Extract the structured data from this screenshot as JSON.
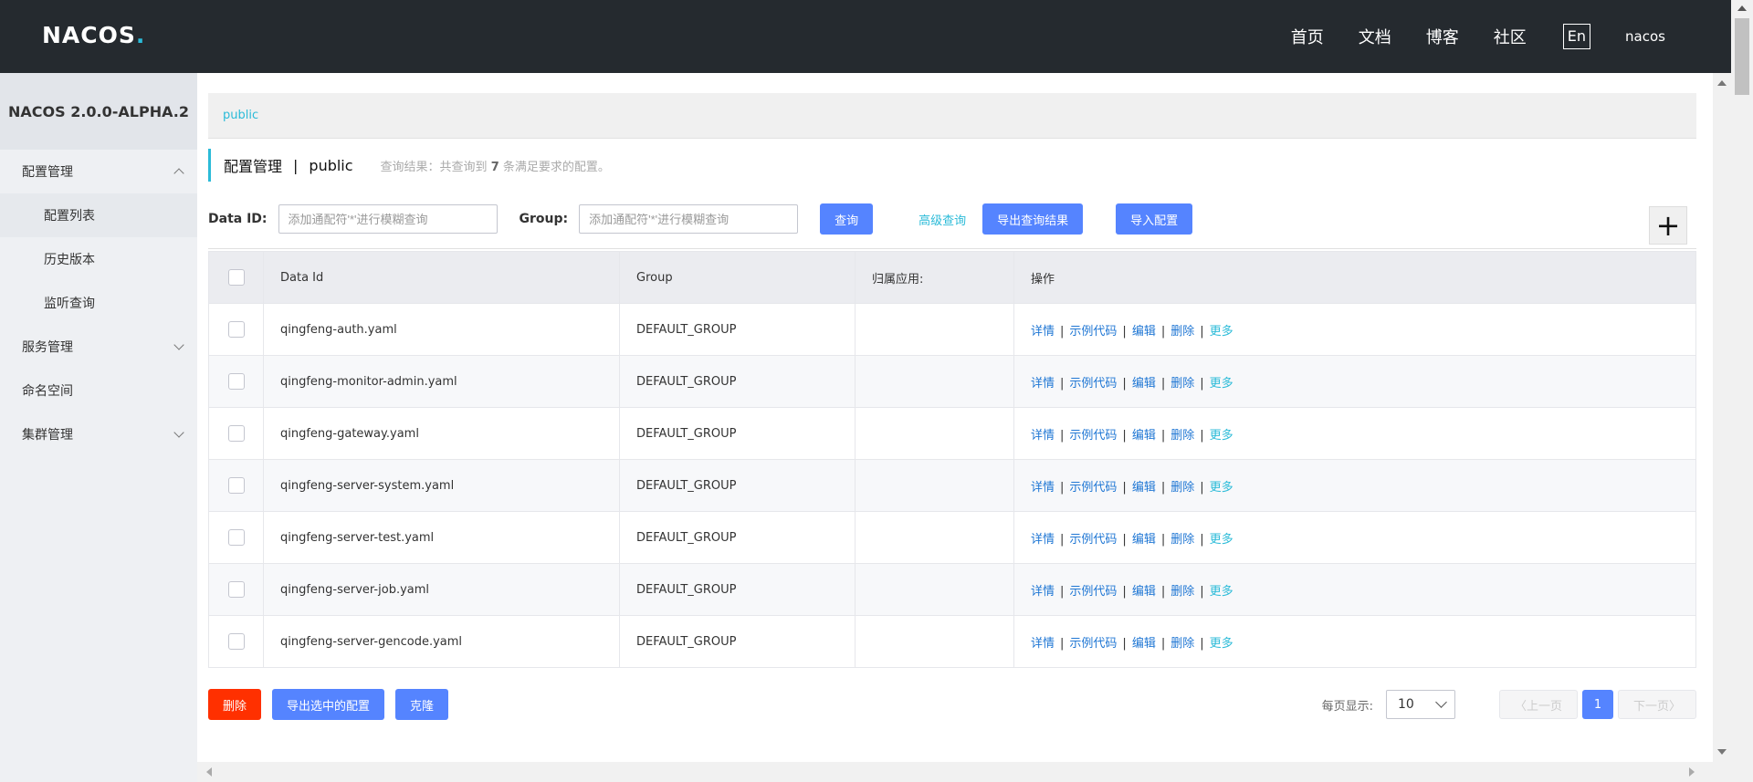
{
  "header": {
    "logo_text": "NACOS",
    "logo_dot": ".",
    "nav": [
      "首页",
      "文档",
      "博客",
      "社区"
    ],
    "lang": "En",
    "user": "nacos"
  },
  "sidebar": {
    "title": "NACOS 2.0.0-ALPHA.2",
    "items": [
      {
        "label": "配置管理",
        "expanded": true
      },
      {
        "label": "配置列表",
        "sub": true,
        "active": true
      },
      {
        "label": "历史版本",
        "sub": true
      },
      {
        "label": "监听查询",
        "sub": true
      },
      {
        "label": "服务管理",
        "expanded": false
      },
      {
        "label": "命名空间"
      },
      {
        "label": "集群管理",
        "expanded": false
      }
    ]
  },
  "namespace": {
    "current": "public"
  },
  "page": {
    "title": "配置管理",
    "separator": "|",
    "namespace": "public",
    "summary_prefix": "查询结果：共查询到",
    "count": "7",
    "summary_suffix": "条满足要求的配置。"
  },
  "search": {
    "data_id_label": "Data ID:",
    "data_id_placeholder": "添加通配符'*'进行模糊查询",
    "group_label": "Group:",
    "group_placeholder": "添加通配符'*'进行模糊查询",
    "query_button": "查询",
    "advanced_link": "高级查询",
    "export_button": "导出查询结果",
    "import_button": "导入配置",
    "add_icon": "plus-icon"
  },
  "table": {
    "headers": [
      "Data Id",
      "Group",
      "归属应用:",
      "操作"
    ],
    "rows": [
      {
        "data_id": "qingfeng-auth.yaml",
        "group": "DEFAULT_GROUP",
        "app": ""
      },
      {
        "data_id": "qingfeng-monitor-admin.yaml",
        "group": "DEFAULT_GROUP",
        "app": ""
      },
      {
        "data_id": "qingfeng-gateway.yaml",
        "group": "DEFAULT_GROUP",
        "app": ""
      },
      {
        "data_id": "qingfeng-server-system.yaml",
        "group": "DEFAULT_GROUP",
        "app": ""
      },
      {
        "data_id": "qingfeng-server-test.yaml",
        "group": "DEFAULT_GROUP",
        "app": ""
      },
      {
        "data_id": "qingfeng-server-job.yaml",
        "group": "DEFAULT_GROUP",
        "app": ""
      },
      {
        "data_id": "qingfeng-server-gencode.yaml",
        "group": "DEFAULT_GROUP",
        "app": ""
      }
    ],
    "ops": {
      "detail": "详情",
      "sample": "示例代码",
      "edit": "编辑",
      "delete": "删除",
      "more": "更多",
      "sep": "|"
    }
  },
  "footer": {
    "delete_button": "删除",
    "export_selected_button": "导出选中的配置",
    "clone_button": "克隆",
    "page_size_label": "每页显示:",
    "page_size": "10",
    "prev": "上一页",
    "current_page": "1",
    "next": "下一页"
  },
  "colors": {
    "header_bg": "#252a2f",
    "accent": "#2bbbd8",
    "primary": "#5584ff",
    "danger": "#ff3000",
    "link": "#2077d4"
  }
}
